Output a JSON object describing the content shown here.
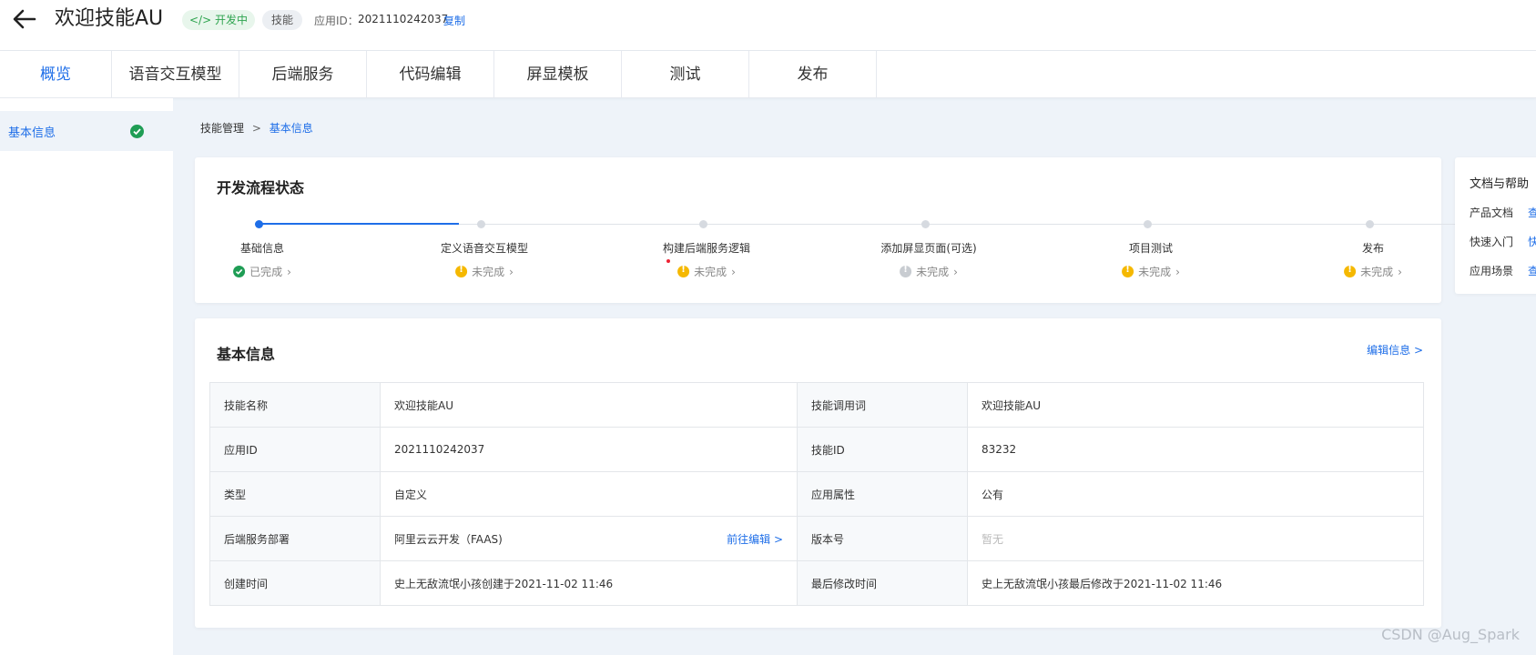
{
  "header": {
    "title": "欢迎技能AU",
    "dev_status": "</> 开发中",
    "type_badge": "技能",
    "appid_label": "应用ID：",
    "appid_value": "2021110242037",
    "copy_label": "复制"
  },
  "tabs": [
    "概览",
    "语音交互模型",
    "后端服务",
    "代码编辑",
    "屏显模板",
    "测试",
    "发布"
  ],
  "sidebar": {
    "items": [
      {
        "label": "基本信息"
      }
    ]
  },
  "breadcrumb": {
    "parent": "技能管理",
    "separator": ">",
    "current": "基本信息"
  },
  "flow": {
    "title": "开发流程状态",
    "steps": [
      {
        "label": "基础信息",
        "status": "已完成"
      },
      {
        "label": "定义语音交互模型",
        "status": "未完成"
      },
      {
        "label": "构建后端服务逻辑",
        "status": "未完成"
      },
      {
        "label": "添加屏显页面(可选)",
        "status": "未完成"
      },
      {
        "label": "项目测试",
        "status": "未完成"
      },
      {
        "label": "发布",
        "status": "未完成"
      }
    ]
  },
  "info": {
    "title": "基本信息",
    "edit_label": "编辑信息 >",
    "rows": [
      {
        "l1": "技能名称",
        "v1": "欢迎技能AU",
        "l2": "技能调用词",
        "v2": "欢迎技能AU"
      },
      {
        "l1": "应用ID",
        "v1": "2021110242037",
        "l2": "技能ID",
        "v2": "83232"
      },
      {
        "l1": "类型",
        "v1": "自定义",
        "l2": "应用属性",
        "v2": "公有"
      },
      {
        "l1": "后端服务部署",
        "v1": "阿里云云开发（FAAS)",
        "v1_link": "前往编辑 >",
        "l2": "版本号",
        "v2": "暂无"
      },
      {
        "l1": "创建时间",
        "v1": "史上无敌流氓小孩创建于2021-11-02 11:46",
        "l2": "最后修改时间",
        "v2": "史上无敌流氓小孩最后修改于2021-11-02 11:46"
      }
    ]
  },
  "help": {
    "title": "文档与帮助",
    "items": [
      {
        "label": "产品文档",
        "link": "查"
      },
      {
        "label": "快速入门",
        "link": "快"
      },
      {
        "label": "应用场景",
        "link": "查"
      }
    ]
  },
  "watermark": "CSDN @Aug_Spark",
  "colors": {
    "accent": "#1e6ee8",
    "success": "#1f9d55",
    "warning": "#f5b800"
  }
}
